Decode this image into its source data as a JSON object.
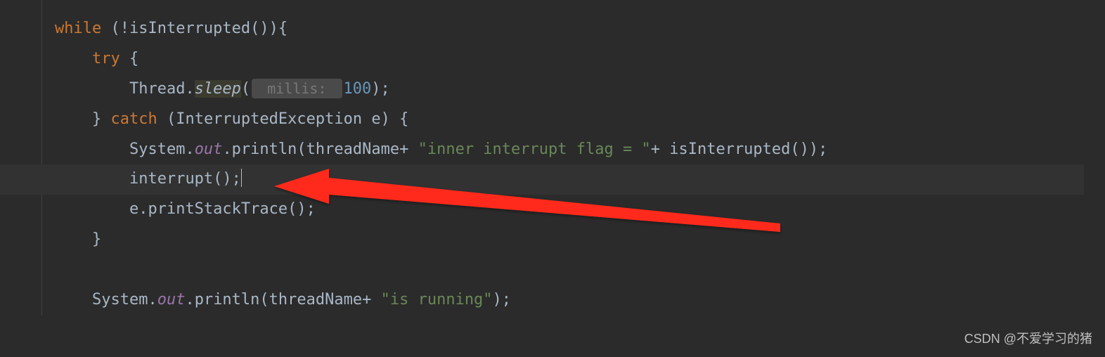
{
  "code": {
    "line1": {
      "kw_while": "while",
      "after_while": " (!isInterrupted()){"
    },
    "line2": {
      "kw_try": "try",
      "after_try": " {"
    },
    "line3": {
      "thread_dot": "Thread.",
      "sleep": "sleep",
      "open": "(",
      "hint": " millis: ",
      "num": "100",
      "close": ");"
    },
    "line4": {
      "brace": "} ",
      "kw_catch": "catch",
      "after_catch": " (InterruptedException e) {"
    },
    "line5": {
      "sys_dot": "System.",
      "out": "out",
      "println_open": ".println(threadName+ ",
      "str": "\"inner interrupt flag = \"",
      "after_str": "+ isInterrupted());"
    },
    "line6": {
      "interrupt": "interrupt();"
    },
    "line7": {
      "printstack": "e.printStackTrace();"
    },
    "line8": {
      "brace": "}"
    },
    "line10": {
      "sys_dot": "System.",
      "out": "out",
      "println_open": ".println(threadName+ ",
      "str": "\"is running\"",
      "close": ");"
    }
  },
  "watermark": "CSDN @不爱学习的猪",
  "arrow": {
    "color": "#ff2a1a"
  }
}
